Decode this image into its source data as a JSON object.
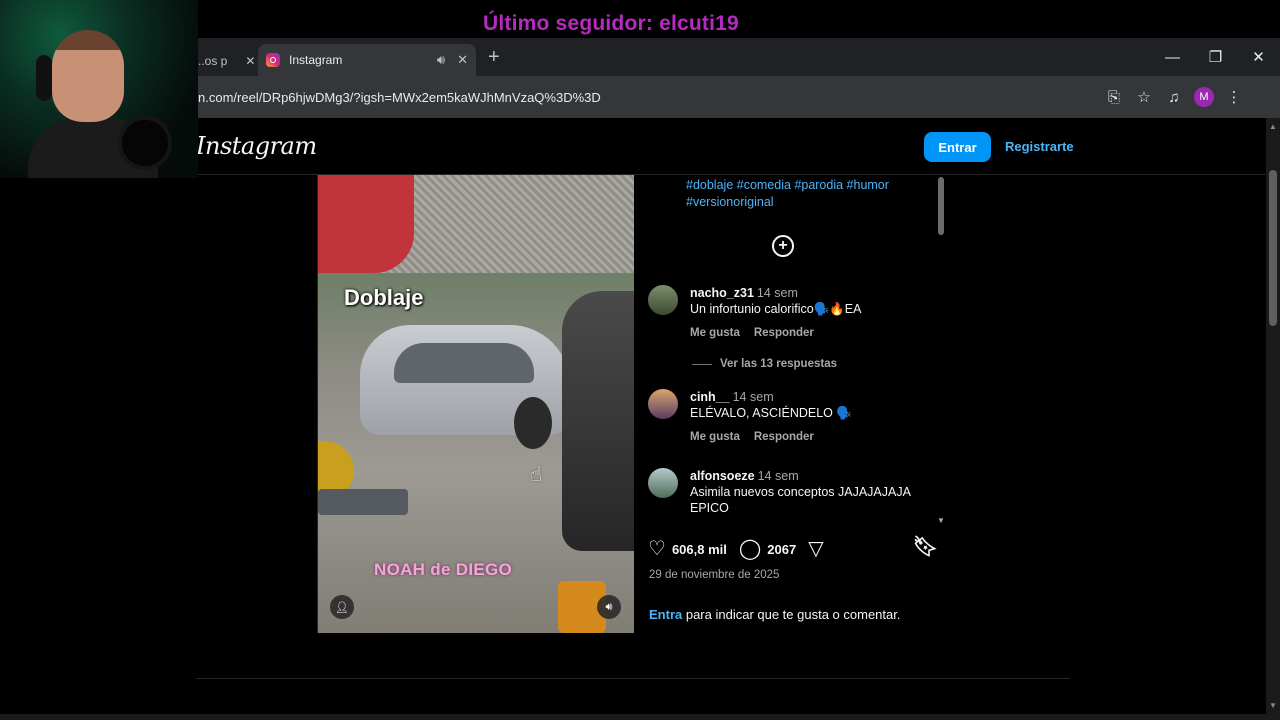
{
  "overlay": {
    "follower_text": "Último seguidor: elcuti19"
  },
  "browser": {
    "prev_tab_fragment": "..os p",
    "tab_title": "Instagram",
    "new_tab_symbol": "+",
    "url": "n.com/reel/DRp6hjwDMg3/?igsh=MWx2em5kaWJhMnVzaQ%3D%3D",
    "profile_initial": "M"
  },
  "header": {
    "logo": "Instagram",
    "login_label": "Entrar",
    "signup_label": "Registrarte"
  },
  "video": {
    "caption_top": "Doblaje",
    "caption_bottom": "NOAH de DIEGO"
  },
  "post": {
    "hashtags": "#doblaje #comedia #parodia #humor #versionoriginal",
    "comments": [
      {
        "user": "nacho_z31",
        "time": "14 sem",
        "text": "Un infortunio calorifico🗣️🔥EA",
        "like_label": "Me gusta",
        "reply_label": "Responder"
      },
      {
        "user": "cinh__",
        "time": "14 sem",
        "text": "ELÉVALO, ASCIÉNDELO 🗣️",
        "like_label": "Me gusta",
        "reply_label": "Responder"
      },
      {
        "user": "alfonsoeze",
        "time": "14 sem",
        "text": "Asimila nuevos conceptos JAJAJAJAJA EPICO"
      }
    ],
    "view_replies": "Ver las 13 respuestas",
    "likes": "606,8 mil",
    "comments_count": "2067",
    "date": "29 de noviembre de 2025",
    "login_link": "Entra",
    "login_prompt": " para indicar que te gusta o comentar."
  },
  "colors": {
    "accent": "#0095f6",
    "link": "#4cb5f9",
    "follower": "#b62ac0"
  }
}
